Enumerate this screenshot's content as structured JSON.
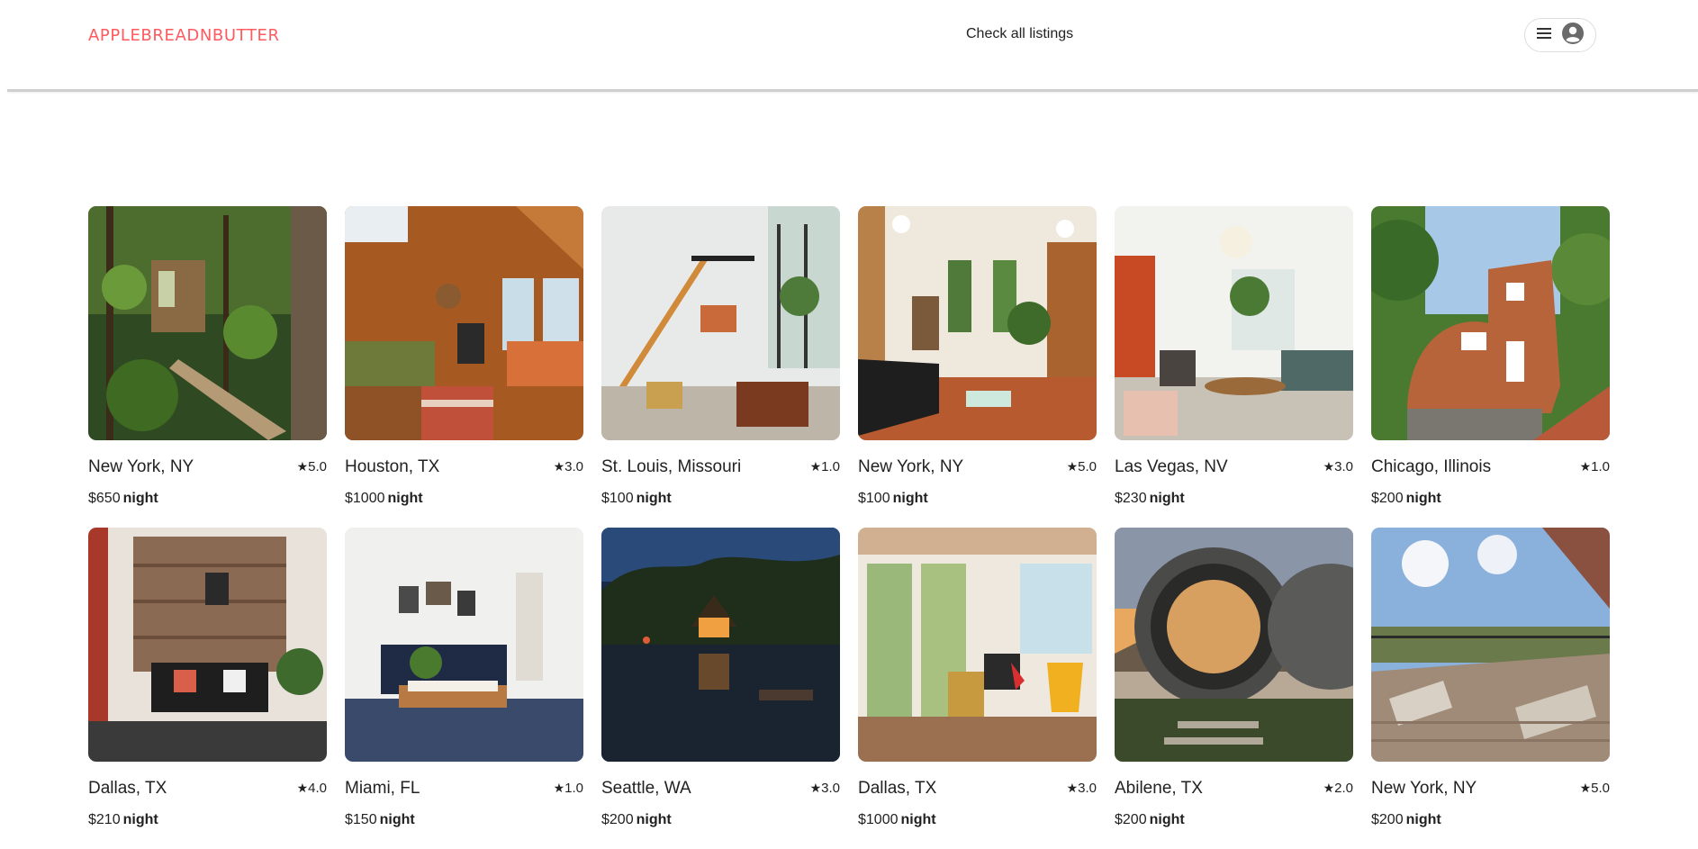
{
  "header": {
    "logo_text": "APPLEBREADNBUTTER",
    "nav_link": "Check all listings",
    "menu_icon": "hamburger-icon",
    "avatar_icon": "user-avatar-icon"
  },
  "colors": {
    "brand": "#ff5a5f",
    "text": "#222222",
    "divider": "#cfcfcf"
  },
  "listings": [
    {
      "city": "New York, NY",
      "rating": "5.0",
      "price": "$650",
      "unit": "night",
      "photo": "treehouse-forest-bridge"
    },
    {
      "city": "Houston, TX",
      "rating": "3.0",
      "price": "$1000",
      "unit": "night",
      "photo": "wood-cabin-interior"
    },
    {
      "city": "St. Louis, Missouri",
      "rating": "1.0",
      "price": "$100",
      "unit": "night",
      "photo": "modern-loft-staircase"
    },
    {
      "city": "New York, NY",
      "rating": "5.0",
      "price": "$100",
      "unit": "night",
      "photo": "living-room-black-sofa"
    },
    {
      "city": "Las Vegas, NV",
      "rating": "3.0",
      "price": "$230",
      "unit": "night",
      "photo": "bright-living-room"
    },
    {
      "city": "Chicago, Illinois",
      "rating": "1.0",
      "price": "$200",
      "unit": "night",
      "photo": "cob-house-garden"
    },
    {
      "city": "Dallas, TX",
      "rating": "4.0",
      "price": "$210",
      "unit": "night",
      "photo": "pallet-wall-lounge"
    },
    {
      "city": "Miami, FL",
      "rating": "1.0",
      "price": "$150",
      "unit": "night",
      "photo": "white-room-navy-sofa"
    },
    {
      "city": "Seattle, WA",
      "rating": "3.0",
      "price": "$200",
      "unit": "night",
      "photo": "lake-cabin-night"
    },
    {
      "city": "Dallas, TX",
      "rating": "3.0",
      "price": "$1000",
      "unit": "night",
      "photo": "sunroom-lamp"
    },
    {
      "city": "Abilene, TX",
      "rating": "2.0",
      "price": "$200",
      "unit": "night",
      "photo": "pipe-pod-sunset"
    },
    {
      "city": "New York, NY",
      "rating": "5.0",
      "price": "$200",
      "unit": "night",
      "photo": "deck-lounge-chairs"
    }
  ]
}
